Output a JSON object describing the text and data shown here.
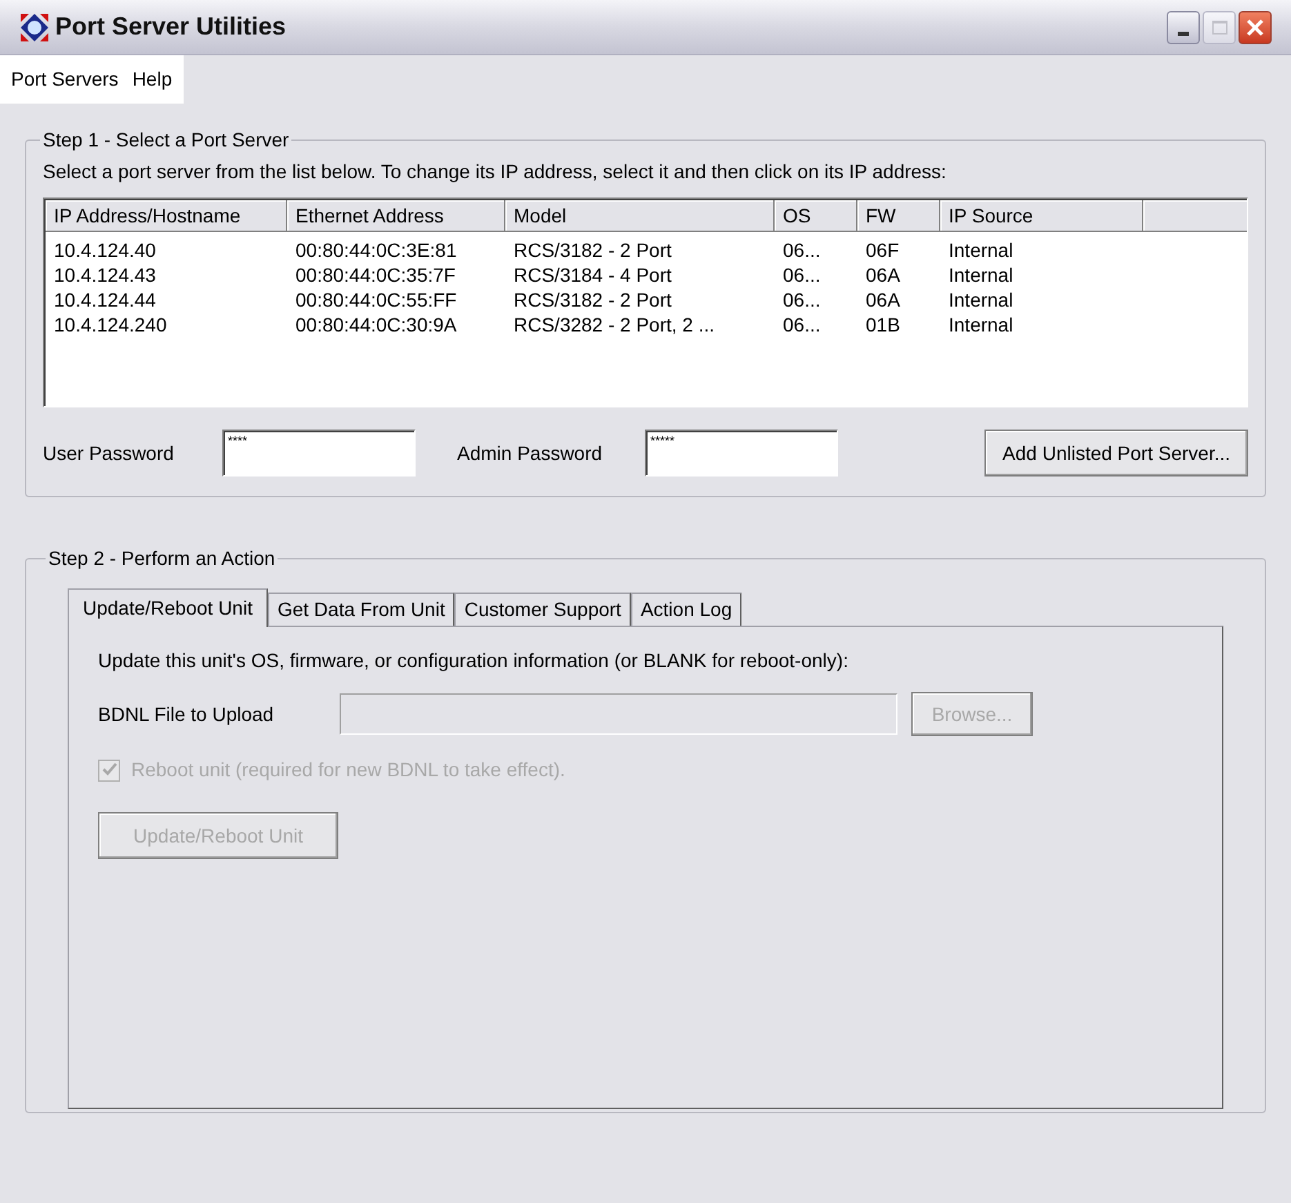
{
  "window": {
    "title": "Port Server Utilities"
  },
  "menu": [
    "Port Servers",
    "Help"
  ],
  "step1": {
    "title": "Step 1 - Select a Port Server",
    "instructions": "Select a port server from the list below.  To change its IP address, select it and then click on its IP address:",
    "columns": [
      "IP Address/Hostname",
      "Ethernet Address",
      "Model",
      "OS",
      "FW",
      "IP Source"
    ],
    "rows": [
      {
        "cells": [
          "10.4.124.40",
          "00:80:44:0C:3E:81",
          "RCS/3182 - 2 Port",
          "06...",
          "06F",
          "Internal"
        ],
        "selected": false
      },
      {
        "cells": [
          "10.4.124.43",
          "00:80:44:0C:35:7F",
          "RCS/3184 - 4 Port",
          "06...",
          "06A",
          "Internal"
        ],
        "selected": false
      },
      {
        "cells": [
          "10.4.124.44",
          "00:80:44:0C:55:FF",
          "RCS/3182 - 2 Port",
          "06...",
          "06A",
          "Internal"
        ],
        "selected": false
      },
      {
        "cells": [
          "10.4.124.240",
          "00:80:44:0C:30:9A",
          "RCS/3282 - 2 Port, 2 ...",
          "06...",
          "01B",
          "Internal"
        ],
        "selected": false
      }
    ],
    "user_password": {
      "label": "User Password",
      "value": "****"
    },
    "admin_password": {
      "label": "Admin Password",
      "value": "*****"
    },
    "add_button": "Add Unlisted Port Server..."
  },
  "step2": {
    "title": "Step 2 - Perform an Action",
    "tabs": [
      {
        "label": "Update/Reboot Unit",
        "selected": true
      },
      {
        "label": "Get Data From Unit",
        "selected": false
      },
      {
        "label": "Customer Support",
        "selected": false
      },
      {
        "label": "Action Log",
        "selected": false
      }
    ],
    "description": "Update this unit's OS, firmware, or configuration information (or BLANK for reboot-only):",
    "file_label": "BDNL File to Upload",
    "browse_button": {
      "label": "Browse...",
      "disabled": true
    },
    "reboot_checkbox": {
      "label": "Reboot unit (required for new BDNL to take effect).",
      "checked": true,
      "disabled": true
    },
    "update_button": {
      "label": "Update/Reboot Unit",
      "disabled": true
    }
  }
}
